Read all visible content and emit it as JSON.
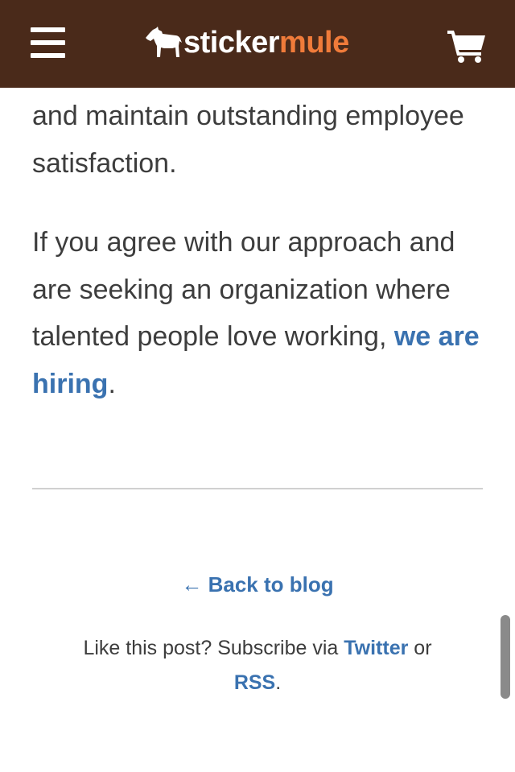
{
  "header": {
    "logo_part1": "sticker",
    "logo_part2": "mule",
    "menu_icon": "hamburger-icon",
    "logo_icon": "mule-icon",
    "cart_icon": "shopping-cart-icon",
    "background_color": "#4a2a1a",
    "logo_accent_color": "#f07b3a"
  },
  "article": {
    "para1": "and maintain outstanding employee satisfaction.",
    "para2_text": "If you agree with our approach and are seeking an organization where talented people love working, ",
    "para2_link": "we are hiring",
    "para2_end": "."
  },
  "footer": {
    "back_label": "← Back to blog",
    "subscribe_prefix": "Like this post? Subscribe via ",
    "twitter_label": "Twitter",
    "subscribe_or": " or ",
    "rss_label": "RSS",
    "subscribe_end": "."
  },
  "colors": {
    "link": "#3a72b0",
    "text": "#3d3d3d",
    "divider": "#d0d0d0"
  }
}
